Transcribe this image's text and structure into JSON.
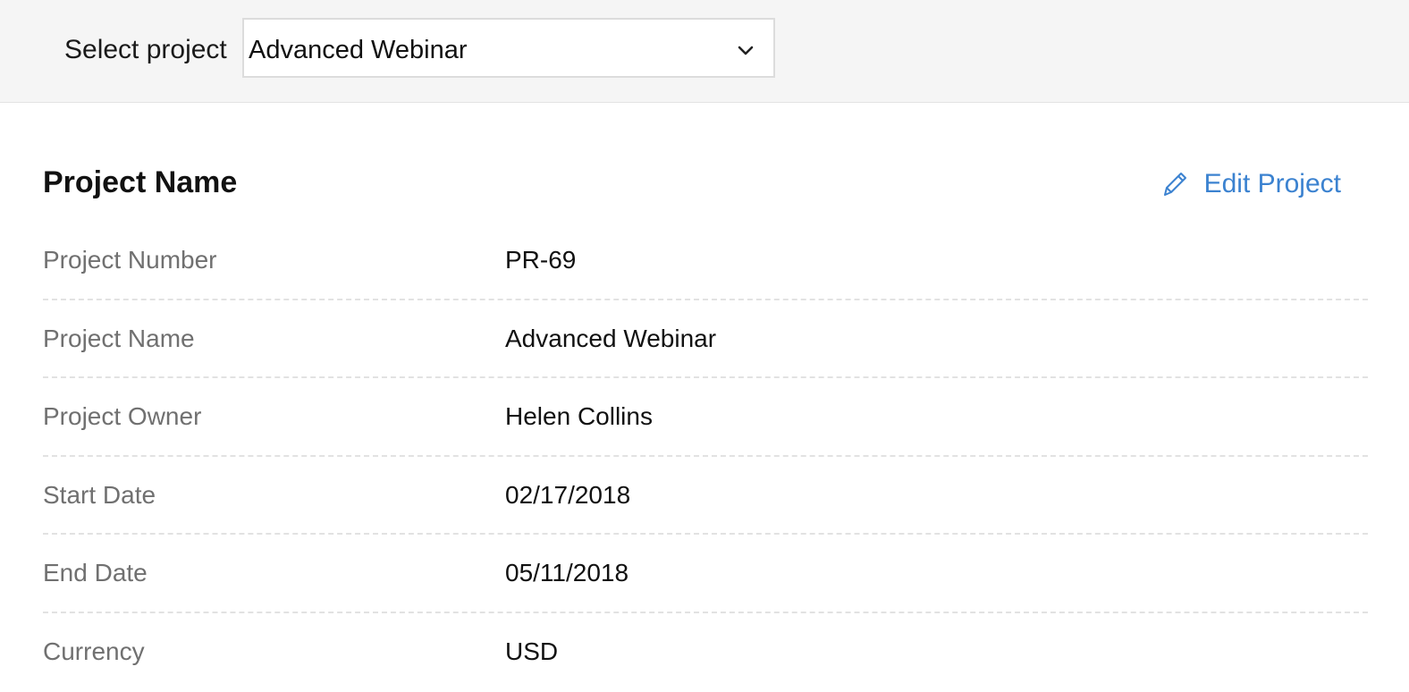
{
  "header": {
    "select_label": "Select project",
    "selected_project": "Advanced Webinar",
    "dropdown_icon": "chevron-down-icon"
  },
  "main": {
    "section_title": "Project Name",
    "edit_label": "Edit Project",
    "edit_icon": "pencil-icon",
    "accent_color": "#3b82d0",
    "fields": [
      {
        "label": "Project Number",
        "value": "PR-69"
      },
      {
        "label": "Project Name",
        "value": "Advanced Webinar"
      },
      {
        "label": "Project Owner",
        "value": "Helen Collins"
      },
      {
        "label": "Start Date",
        "value": "02/17/2018"
      },
      {
        "label": "End Date",
        "value": "05/11/2018"
      },
      {
        "label": "Currency",
        "value": "USD"
      }
    ]
  }
}
